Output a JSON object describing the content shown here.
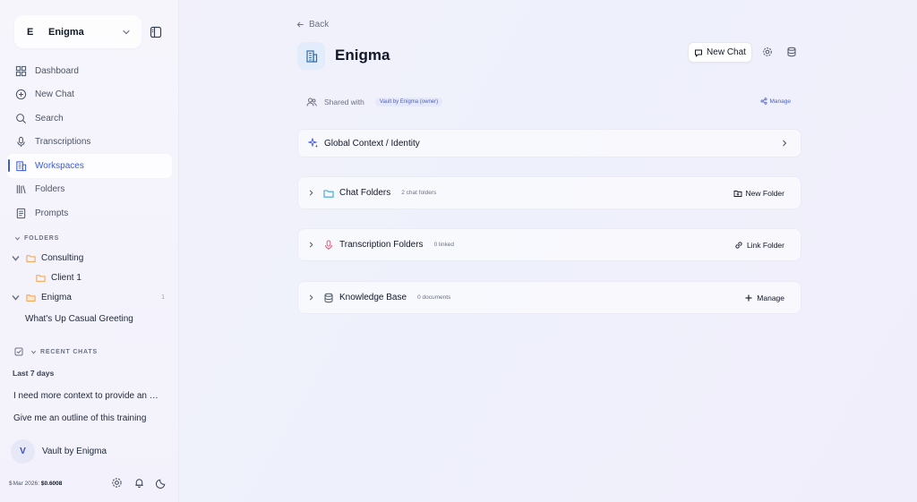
{
  "workspace_switcher": {
    "letter": "E",
    "name": "Enigma"
  },
  "nav": [
    {
      "label": "Dashboard",
      "icon": "dashboard-icon"
    },
    {
      "label": "New Chat",
      "icon": "plus-circle-icon"
    },
    {
      "label": "Search",
      "icon": "search-icon"
    },
    {
      "label": "Transcriptions",
      "icon": "microphone-icon"
    },
    {
      "label": "Workspaces",
      "icon": "building-icon",
      "active": true
    },
    {
      "label": "Folders",
      "icon": "library-icon"
    },
    {
      "label": "Prompts",
      "icon": "book-icon"
    }
  ],
  "folders_section": {
    "label": "FOLDERS",
    "items": [
      {
        "label": "Consulting",
        "children": [
          {
            "label": "Client 1"
          }
        ]
      },
      {
        "label": "Enigma",
        "count": "1",
        "children": [
          {
            "label": "What's Up Casual Greeting"
          }
        ]
      }
    ]
  },
  "recent_chats": {
    "label": "RECENT CHATS",
    "group_label": "Last 7 days",
    "items": [
      "I need more context to provide an …",
      "Give me an outline of this training"
    ]
  },
  "user": {
    "initial": "V",
    "name": "Vault by Enigma"
  },
  "usage": {
    "period": "Mar 2026:",
    "amount": "$0.6008"
  },
  "main": {
    "back_label": "Back",
    "title": "Enigma",
    "new_chat_label": "New Chat",
    "shared": {
      "label": "Shared with",
      "owner_badge": "Vault by Enigma (owner)",
      "manage_label": "Manage"
    },
    "cards": {
      "global_context": {
        "title": "Global Context / Identity"
      },
      "chat_folders": {
        "title": "Chat Folders",
        "meta": "2 chat folders",
        "action": "New Folder"
      },
      "transcription_folders": {
        "title": "Transcription Folders",
        "meta": "0 linked",
        "action": "Link Folder"
      },
      "knowledge_base": {
        "title": "Knowledge Base",
        "meta": "0 documents",
        "action": "Manage"
      }
    }
  },
  "colors": {
    "accent": "#3b5bdb",
    "folder": "#f0a24b",
    "mic": "#e05a7a",
    "chat_folder": "#3ba3d9"
  }
}
